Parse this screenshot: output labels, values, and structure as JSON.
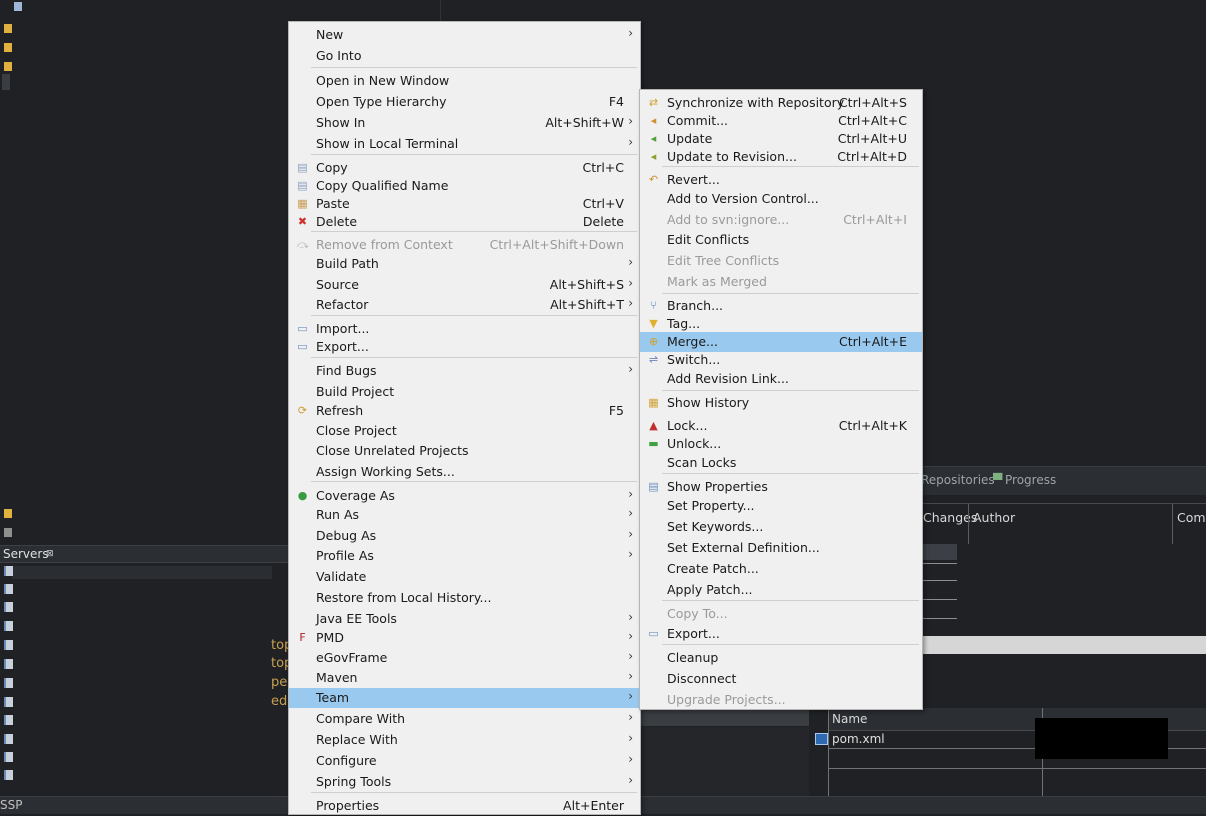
{
  "context_menu": {
    "items": [
      {
        "label": "New",
        "accel": "",
        "submenu": true
      },
      {
        "label": "Go Into",
        "accel": "",
        "submenu": false
      },
      {
        "label": "Open in New Window",
        "accel": "",
        "submenu": false
      },
      {
        "label": "Open Type Hierarchy",
        "accel": "F4",
        "submenu": false
      },
      {
        "label": "Show In",
        "accel": "Alt+Shift+W",
        "submenu": true
      },
      {
        "label": "Show in Local Terminal",
        "accel": "",
        "submenu": true
      },
      {
        "label": "Copy",
        "accel": "Ctrl+C",
        "submenu": false,
        "icon": "copy-icon"
      },
      {
        "label": "Copy Qualified Name",
        "accel": "",
        "submenu": false,
        "icon": "copy-qualified-icon"
      },
      {
        "label": "Paste",
        "accel": "Ctrl+V",
        "submenu": false,
        "icon": "paste-icon"
      },
      {
        "label": "Delete",
        "accel": "Delete",
        "submenu": false,
        "icon": "delete-icon"
      },
      {
        "label": "Remove from Context",
        "accel": "Ctrl+Alt+Shift+Down",
        "submenu": false,
        "disabled": true,
        "icon": "remove-context-icon"
      },
      {
        "label": "Build Path",
        "accel": "",
        "submenu": true
      },
      {
        "label": "Source",
        "accel": "Alt+Shift+S",
        "submenu": true
      },
      {
        "label": "Refactor",
        "accel": "Alt+Shift+T",
        "submenu": true
      },
      {
        "label": "Import...",
        "accel": "",
        "submenu": false,
        "icon": "import-icon"
      },
      {
        "label": "Export...",
        "accel": "",
        "submenu": false,
        "icon": "export-icon"
      },
      {
        "label": "Find Bugs",
        "accel": "",
        "submenu": true
      },
      {
        "label": "Build Project",
        "accel": "",
        "submenu": false
      },
      {
        "label": "Refresh",
        "accel": "F5",
        "submenu": false,
        "icon": "refresh-icon"
      },
      {
        "label": "Close Project",
        "accel": "",
        "submenu": false
      },
      {
        "label": "Close Unrelated Projects",
        "accel": "",
        "submenu": false
      },
      {
        "label": "Assign Working Sets...",
        "accel": "",
        "submenu": false
      },
      {
        "label": "Coverage As",
        "accel": "",
        "submenu": true,
        "icon": "coverage-icon"
      },
      {
        "label": "Run As",
        "accel": "",
        "submenu": true
      },
      {
        "label": "Debug As",
        "accel": "",
        "submenu": true
      },
      {
        "label": "Profile As",
        "accel": "",
        "submenu": true
      },
      {
        "label": "Validate",
        "accel": "",
        "submenu": false
      },
      {
        "label": "Restore from Local History...",
        "accel": "",
        "submenu": false
      },
      {
        "label": "Java EE Tools",
        "accel": "",
        "submenu": true
      },
      {
        "label": "PMD",
        "accel": "",
        "submenu": true,
        "icon": "pmd-icon"
      },
      {
        "label": "eGovFrame",
        "accel": "",
        "submenu": true
      },
      {
        "label": "Maven",
        "accel": "",
        "submenu": true
      },
      {
        "label": "Team",
        "accel": "",
        "submenu": true,
        "highlighted": true
      },
      {
        "label": "Compare With",
        "accel": "",
        "submenu": true
      },
      {
        "label": "Replace With",
        "accel": "",
        "submenu": true
      },
      {
        "label": "Configure",
        "accel": "",
        "submenu": true
      },
      {
        "label": "Spring Tools",
        "accel": "",
        "submenu": true
      },
      {
        "label": "Properties",
        "accel": "Alt+Enter",
        "submenu": false
      }
    ]
  },
  "team_menu": {
    "items": [
      {
        "label": "Synchronize with Repository",
        "accel": "Ctrl+Alt+S",
        "icon": "synchronize-icon"
      },
      {
        "label": "Commit...",
        "accel": "Ctrl+Alt+C",
        "icon": "commit-icon"
      },
      {
        "label": "Update",
        "accel": "Ctrl+Alt+U",
        "icon": "update-icon"
      },
      {
        "label": "Update to Revision...",
        "accel": "Ctrl+Alt+D",
        "icon": "update-revision-icon"
      },
      {
        "label": "Revert...",
        "accel": "",
        "icon": "revert-icon"
      },
      {
        "label": "Add to Version Control...",
        "accel": ""
      },
      {
        "label": "Add to svn:ignore...",
        "accel": "Ctrl+Alt+I",
        "disabled": true
      },
      {
        "label": "Edit Conflicts",
        "accel": ""
      },
      {
        "label": "Edit Tree Conflicts",
        "accel": "",
        "disabled": true
      },
      {
        "label": "Mark as Merged",
        "accel": "",
        "disabled": true
      },
      {
        "label": "Branch...",
        "accel": "",
        "icon": "branch-icon"
      },
      {
        "label": "Tag...",
        "accel": "",
        "icon": "tag-icon"
      },
      {
        "label": "Merge...",
        "accel": "Ctrl+Alt+E",
        "icon": "merge-icon",
        "highlighted": true
      },
      {
        "label": "Switch...",
        "accel": "",
        "icon": "switch-icon"
      },
      {
        "label": "Add Revision Link...",
        "accel": ""
      },
      {
        "label": "Show History",
        "accel": "",
        "icon": "history-icon"
      },
      {
        "label": "Lock...",
        "accel": "Ctrl+Alt+K",
        "icon": "lock-icon"
      },
      {
        "label": "Unlock...",
        "accel": "",
        "icon": "unlock-icon"
      },
      {
        "label": "Scan Locks",
        "accel": ""
      },
      {
        "label": "Show Properties",
        "accel": "",
        "icon": "properties-icon"
      },
      {
        "label": "Set Property...",
        "accel": ""
      },
      {
        "label": "Set Keywords...",
        "accel": ""
      },
      {
        "label": "Set External Definition...",
        "accel": ""
      },
      {
        "label": "Create Patch...",
        "accel": ""
      },
      {
        "label": "Apply Patch...",
        "accel": ""
      },
      {
        "label": "Copy To...",
        "accel": "",
        "disabled": true
      },
      {
        "label": "Export...",
        "accel": "",
        "icon": "export-icon"
      },
      {
        "label": "Cleanup",
        "accel": ""
      },
      {
        "label": "Disconnect",
        "accel": ""
      },
      {
        "label": "Upgrade Projects...",
        "accel": "",
        "disabled": true
      }
    ]
  },
  "servers_view": {
    "tab_label": "Servers",
    "close_glyph": "⊠"
  },
  "history_view": {
    "tabs": [
      "Repositories",
      "Progress"
    ],
    "columns": [
      "Changes",
      "Author",
      "Comm"
    ]
  },
  "changed_files": {
    "columns": [
      "Name"
    ],
    "rows": [
      {
        "name": "pom.xml"
      }
    ]
  },
  "status_bar": {
    "text": "SSP"
  },
  "code_snippet": {
    "lines": [
      "top",
      "top",
      "pe",
      "ed"
    ]
  },
  "colors": {
    "menu_bg": "#f0f0f0",
    "highlight": "#99c9ef",
    "ide_bg": "#1f2125"
  }
}
